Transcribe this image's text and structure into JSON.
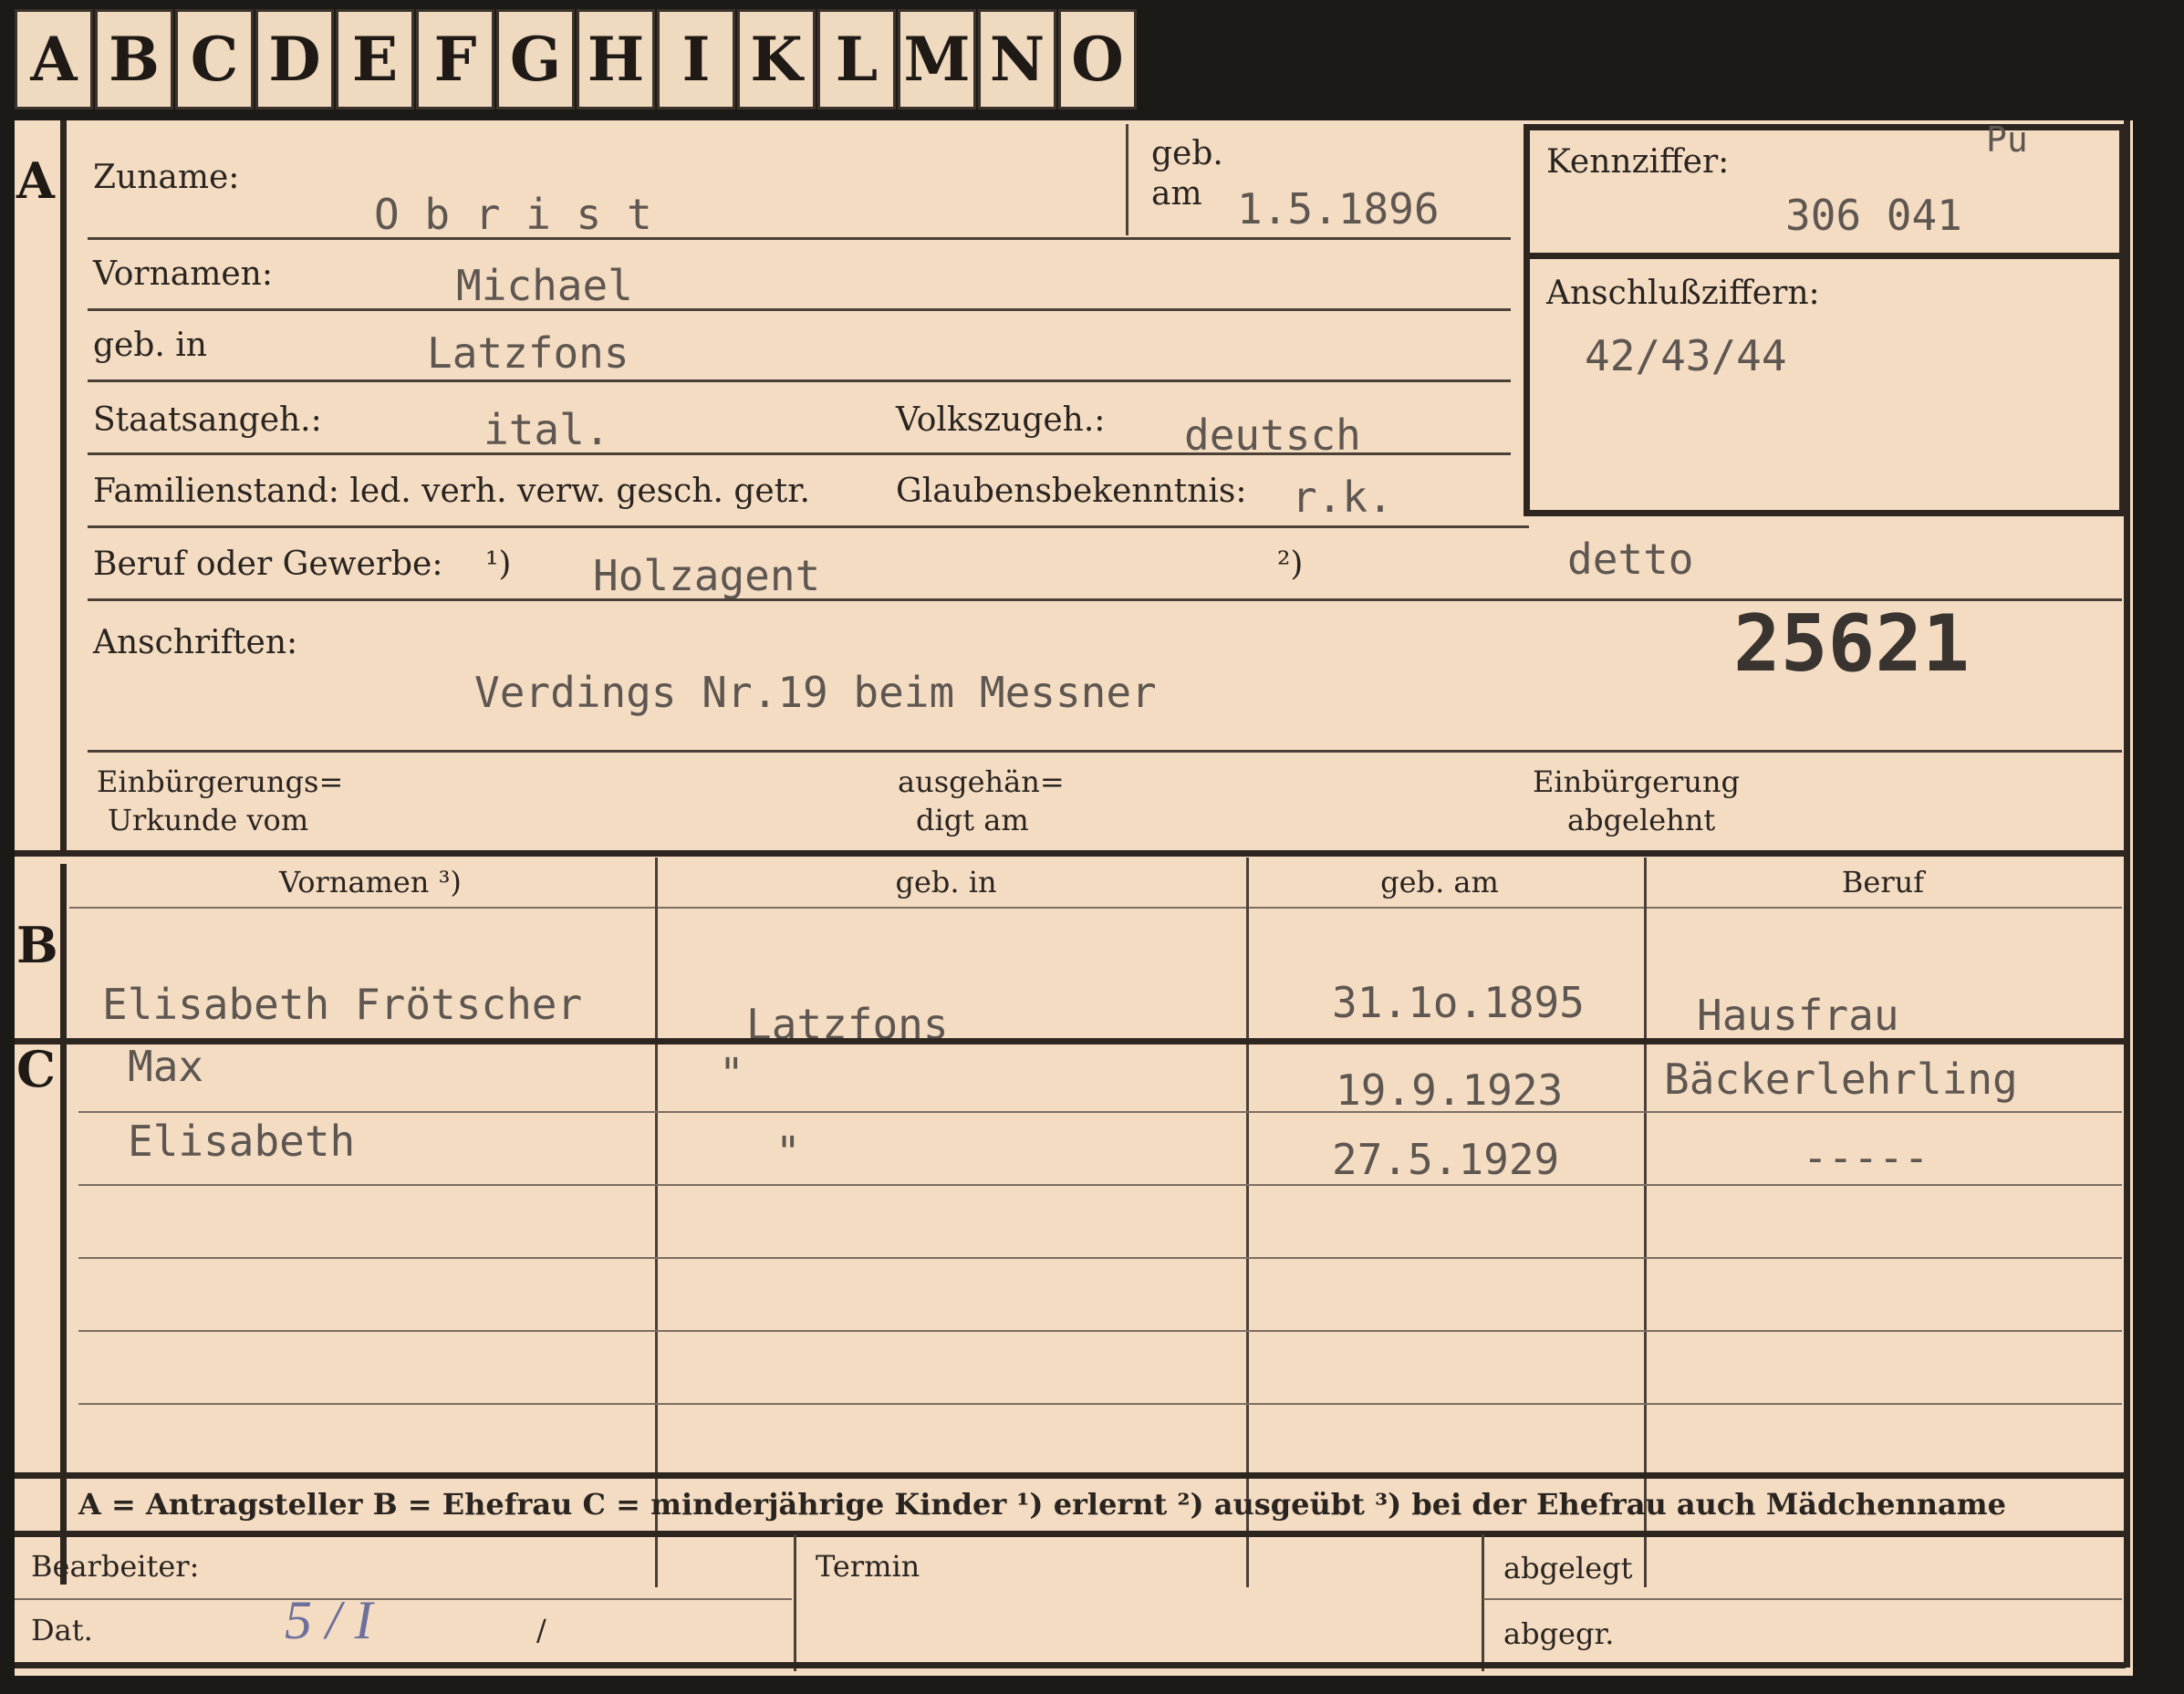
{
  "tabs": [
    "A",
    "B",
    "C",
    "D",
    "E",
    "F",
    "G",
    "H",
    "I",
    "K",
    "L",
    "M",
    "N",
    "O"
  ],
  "sections": {
    "a": "A",
    "b": "B",
    "c": "C"
  },
  "applicant": {
    "surname_label": "Zuname:",
    "surname": "O b r i s t",
    "born_label_1": "geb.",
    "born_label_2": "am",
    "born_date": "1.5.1896",
    "given_label": "Vornamen:",
    "given": "Michael",
    "birthplace_label": "geb. in",
    "birthplace": "Latzfons",
    "citizenship_label": "Staatsangeh.:",
    "citizenship": "ital.",
    "ethnicity_label": "Volkszugeh.:",
    "ethnicity": "deutsch",
    "family_label": "Familienstand: led. verh. verw. gesch. getr.",
    "religion_label": "Glaubensbekenntnis:",
    "religion": "r.k.",
    "occupation_label": "Beruf oder Gewerbe:",
    "occupation_note1": "¹)",
    "occupation": "Holzagent",
    "occupation_note2": "²)",
    "occupation2": "detto",
    "address_label": "Anschriften:",
    "address": "Verdings Nr.19 beim Messner",
    "naturalization_label_1": "Einbürgerungs=",
    "naturalization_label_2": "Urkunde vom",
    "handed_label_1": "ausgehän=",
    "handed_label_2": "digt am",
    "rejected_label_1": "Einbürgerung",
    "rejected_label_2": "abgelehnt"
  },
  "kennziffer": {
    "label": "Kennziffer:",
    "value": "306 041",
    "note": "Pu",
    "anschluss_label": "Anschlußziffern:",
    "anschluss": "42/43/44"
  },
  "card_number": "25621",
  "table": {
    "headers": [
      "Vornamen ³)",
      "geb. in",
      "geb. am",
      "Beruf"
    ],
    "spouse": {
      "name": "Elisabeth Frötscher",
      "place": "Latzfons",
      "date": "31.1o.1895",
      "job": "Hausfrau"
    },
    "children": [
      {
        "name": "Max",
        "place": "\"",
        "date": "19.9.1923",
        "job": "Bäckerlehrling"
      },
      {
        "name": "Elisabeth",
        "place": "\"",
        "date": "27.5.1929",
        "job": "-----"
      }
    ]
  },
  "legend": "A = Antragsteller   B = Ehefrau   C = minderjährige Kinder   ¹) erlernt   ²) ausgeübt   ³) bei der Ehefrau auch Mädchenname",
  "footer": {
    "editor": "Bearbeiter:",
    "date": "Dat.",
    "date_slash": "/",
    "termin": "Termin",
    "filed": "abgelegt",
    "given_out": "abgegr."
  },
  "stamp": "5 / I",
  "colors": {
    "paper": "#f3dcc2",
    "ink": "#2a2420",
    "typewriter": "#5e5650",
    "stamp": "#6d6f9c"
  }
}
